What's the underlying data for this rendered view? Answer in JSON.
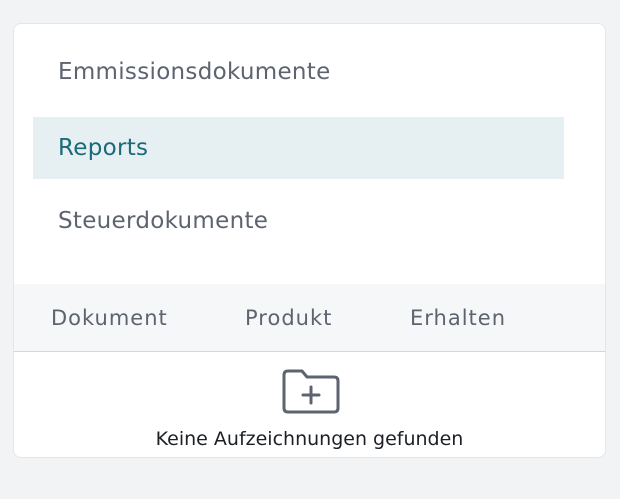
{
  "document_tabs": {
    "items": [
      {
        "label": "Emmissionsdokumente",
        "active": false
      },
      {
        "label": "Reports",
        "active": true
      },
      {
        "label": "Steuerdokumente",
        "active": false
      }
    ]
  },
  "table": {
    "columns": [
      "Dokument",
      "Produkt",
      "Erhalten"
    ],
    "empty_state": {
      "icon": "folder-plus-icon",
      "message": "Keine Aufzeichnungen gefunden"
    }
  },
  "colors": {
    "active_background": "#e6eff2",
    "active_text": "#1a6a78",
    "muted_text": "#5d6470",
    "header_background": "#f6f7f9"
  }
}
